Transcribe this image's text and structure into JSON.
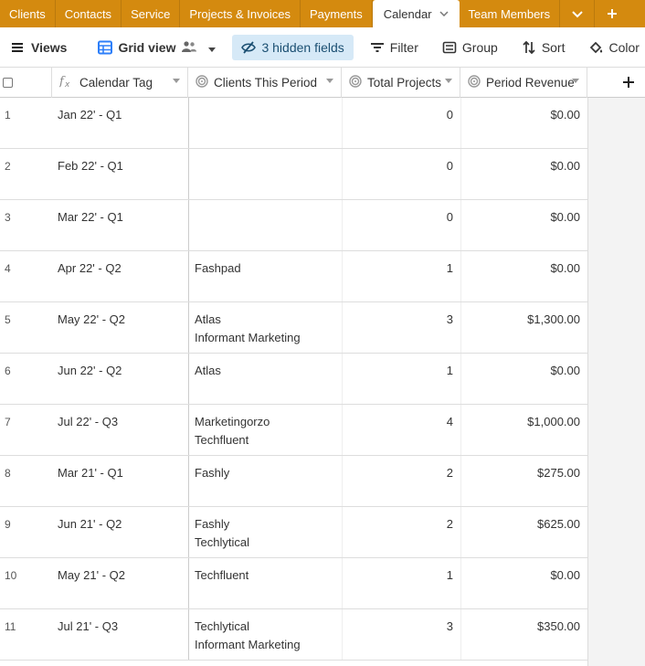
{
  "tabs": [
    {
      "label": "Clients"
    },
    {
      "label": "Contacts"
    },
    {
      "label": "Service"
    },
    {
      "label": "Projects & Invoices"
    },
    {
      "label": "Payments"
    },
    {
      "label": "Calendar",
      "active": true
    },
    {
      "label": "Team Members"
    }
  ],
  "toolbar": {
    "views_label": "Views",
    "view_name": "Grid view",
    "hidden_fields_label": "3 hidden fields",
    "filter_label": "Filter",
    "group_label": "Group",
    "sort_label": "Sort",
    "color_label": "Color"
  },
  "columns": {
    "calendar_tag": "Calendar Tag",
    "clients_this_period": "Clients This Period",
    "total_projects": "Total Projects",
    "period_revenue": "Period Revenue"
  },
  "rows": [
    {
      "num": "1",
      "tag": "Jan 22' - Q1",
      "clients": [
        "",
        ""
      ],
      "total": "0",
      "revenue": "$0.00"
    },
    {
      "num": "2",
      "tag": "Feb 22' - Q1",
      "clients": [
        "",
        ""
      ],
      "total": "0",
      "revenue": "$0.00"
    },
    {
      "num": "3",
      "tag": "Mar 22' - Q1",
      "clients": [
        "",
        ""
      ],
      "total": "0",
      "revenue": "$0.00"
    },
    {
      "num": "4",
      "tag": "Apr 22' - Q2",
      "clients": [
        "Fashpad",
        ""
      ],
      "total": "1",
      "revenue": "$0.00"
    },
    {
      "num": "5",
      "tag": "May 22' - Q2",
      "clients": [
        "Atlas",
        "Informant Marketing"
      ],
      "total": "3",
      "revenue": "$1,300.00"
    },
    {
      "num": "6",
      "tag": "Jun 22' - Q2",
      "clients": [
        "Atlas",
        ""
      ],
      "total": "1",
      "revenue": "$0.00"
    },
    {
      "num": "7",
      "tag": "Jul 22' - Q3",
      "clients": [
        "Marketingorzo",
        "Techfluent"
      ],
      "total": "4",
      "revenue": "$1,000.00"
    },
    {
      "num": "8",
      "tag": "Mar 21' - Q1",
      "clients": [
        "Fashly",
        ""
      ],
      "total": "2",
      "revenue": "$275.00"
    },
    {
      "num": "9",
      "tag": "Jun 21' - Q2",
      "clients": [
        "Fashly",
        "Techlytical"
      ],
      "total": "2",
      "revenue": "$625.00"
    },
    {
      "num": "10",
      "tag": "May 21' - Q2",
      "clients": [
        "Techfluent",
        ""
      ],
      "total": "1",
      "revenue": "$0.00"
    },
    {
      "num": "11",
      "tag": "Jul 21' - Q3",
      "clients": [
        "Techlytical",
        "Informant Marketing"
      ],
      "total": "3",
      "revenue": "$350.00"
    }
  ],
  "colors": {
    "tab_bar": "#d48a0f",
    "hidden_fields_bg": "#d6e9f7",
    "grid_blue": "#2d7ff9"
  },
  "icons": {
    "views": "hamburger-icon",
    "grid_view": "grid-icon",
    "collaborators": "people-icon",
    "hidden_fields": "eye-slash-icon",
    "filter": "filter-icon",
    "group": "group-icon",
    "sort": "sort-icon",
    "color": "paint-bucket-icon",
    "row_height": "row-height-icon",
    "formula_field": "formula-icon",
    "rollup_field": "rollup-icon",
    "add_field": "plus-icon"
  }
}
